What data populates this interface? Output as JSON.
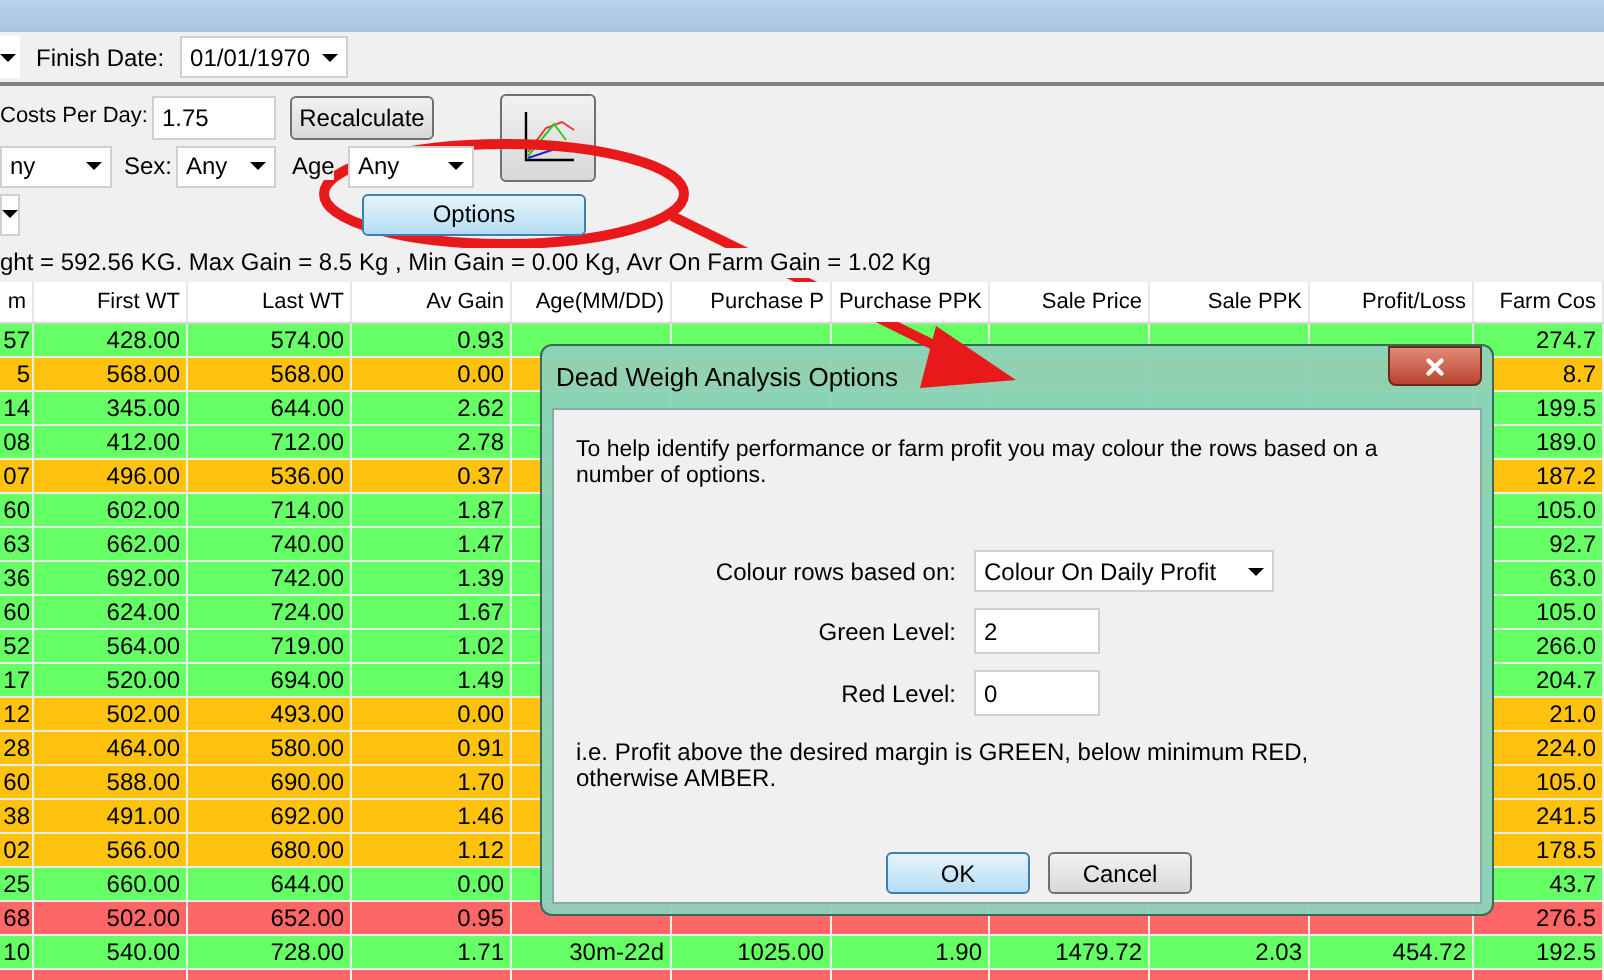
{
  "toolbar": {
    "finish_date_label": "Finish Date:",
    "finish_date": "01/01/1970"
  },
  "costs": {
    "label": "Costs Per Day:",
    "value": "1.75"
  },
  "recalculate_button": "Recalculate",
  "filters": [
    {
      "value": "ny"
    },
    {
      "label": "Sex:",
      "value": "Any"
    },
    {
      "label": "Age",
      "value": "Any"
    }
  ],
  "options_button": "Options",
  "summary": "ght = 592.56 KG. Max Gain = 8.5 Kg , Min Gain = 0.00 Kg, Avr On Farm Gain = 1.02 Kg",
  "table": {
    "columns": [
      "m",
      "First WT",
      "Last WT",
      "Av Gain",
      "Age(MM/DD)",
      "Purchase P",
      "Purchase PPK",
      "Sale Price",
      "Sale PPK",
      "Profit/Loss",
      "Farm Cos"
    ],
    "rows": [
      {
        "color": "#66ff66",
        "cells": [
          "57",
          "428.00",
          "574.00",
          "0.93",
          null,
          null,
          null,
          null,
          null,
          null,
          "274.7"
        ]
      },
      {
        "color": "#ffc20e",
        "cells": [
          "5",
          "568.00",
          "568.00",
          "0.00",
          null,
          null,
          null,
          null,
          null,
          null,
          "8.7"
        ]
      },
      {
        "color": "#66ff66",
        "cells": [
          "14",
          "345.00",
          "644.00",
          "2.62",
          null,
          null,
          null,
          null,
          null,
          null,
          "199.5"
        ]
      },
      {
        "color": "#66ff66",
        "cells": [
          "08",
          "412.00",
          "712.00",
          "2.78",
          null,
          null,
          null,
          null,
          null,
          null,
          "189.0"
        ]
      },
      {
        "color": "#ffc20e",
        "cells": [
          "07",
          "496.00",
          "536.00",
          "0.37",
          null,
          null,
          null,
          null,
          null,
          null,
          "187.2"
        ]
      },
      {
        "color": "#66ff66",
        "cells": [
          "60",
          "602.00",
          "714.00",
          "1.87",
          null,
          null,
          null,
          null,
          null,
          null,
          "105.0"
        ]
      },
      {
        "color": "#66ff66",
        "cells": [
          "63",
          "662.00",
          "740.00",
          "1.47",
          null,
          null,
          null,
          null,
          null,
          null,
          "92.7"
        ]
      },
      {
        "color": "#66ff66",
        "cells": [
          "36",
          "692.00",
          "742.00",
          "1.39",
          null,
          null,
          null,
          null,
          null,
          null,
          "63.0"
        ]
      },
      {
        "color": "#66ff66",
        "cells": [
          "60",
          "624.00",
          "724.00",
          "1.67",
          null,
          null,
          null,
          null,
          null,
          null,
          "105.0"
        ]
      },
      {
        "color": "#66ff66",
        "cells": [
          "52",
          "564.00",
          "719.00",
          "1.02",
          null,
          null,
          null,
          null,
          null,
          null,
          "266.0"
        ]
      },
      {
        "color": "#66ff66",
        "cells": [
          "17",
          "520.00",
          "694.00",
          "1.49",
          null,
          null,
          null,
          null,
          null,
          null,
          "204.7"
        ]
      },
      {
        "color": "#ffc20e",
        "cells": [
          "12",
          "502.00",
          "493.00",
          "0.00",
          null,
          null,
          null,
          null,
          null,
          null,
          "21.0"
        ]
      },
      {
        "color": "#ffc20e",
        "cells": [
          "28",
          "464.00",
          "580.00",
          "0.91",
          null,
          null,
          null,
          null,
          null,
          null,
          "224.0"
        ]
      },
      {
        "color": "#ffc20e",
        "cells": [
          "60",
          "588.00",
          "690.00",
          "1.70",
          null,
          null,
          null,
          null,
          null,
          null,
          "105.0"
        ]
      },
      {
        "color": "#ffc20e",
        "cells": [
          "38",
          "491.00",
          "692.00",
          "1.46",
          null,
          null,
          null,
          null,
          null,
          null,
          "241.5"
        ]
      },
      {
        "color": "#ffc20e",
        "cells": [
          "02",
          "566.00",
          "680.00",
          "1.12",
          null,
          null,
          null,
          null,
          null,
          null,
          "178.5"
        ]
      },
      {
        "color": "#66ff66",
        "cells": [
          "25",
          "660.00",
          "644.00",
          "0.00",
          null,
          null,
          null,
          null,
          null,
          null,
          "43.7"
        ]
      },
      {
        "color": "#ff6666",
        "cells": [
          "68",
          "502.00",
          "652.00",
          "0.95",
          null,
          null,
          null,
          null,
          null,
          null,
          "276.5"
        ]
      },
      {
        "color": "#66ff66",
        "cells": [
          "10",
          "540.00",
          "728.00",
          "1.71",
          "30m-22d",
          "1025.00",
          "1.90",
          "1479.72",
          "2.03",
          "454.72",
          "192.5"
        ]
      },
      {
        "color": "#ff6666"
      }
    ]
  },
  "dialog": {
    "title": "Dead Weigh Analysis Options",
    "intro": "To help identify performance or farm profit you may colour the rows based on a number of options.",
    "fields": [
      {
        "kind": "select",
        "label": "Colour rows based on:",
        "value": "Colour On Daily Profit"
      },
      {
        "kind": "input",
        "label": "Green Level:",
        "value": "2"
      },
      {
        "kind": "input",
        "label": "Red Level:",
        "value": "0"
      }
    ],
    "note": "i.e. Profit above the desired margin is GREEN, below minimum RED, otherwise AMBER.",
    "buttons": [
      {
        "label": "OK",
        "default": true
      },
      {
        "label": "Cancel",
        "default": false
      }
    ]
  }
}
